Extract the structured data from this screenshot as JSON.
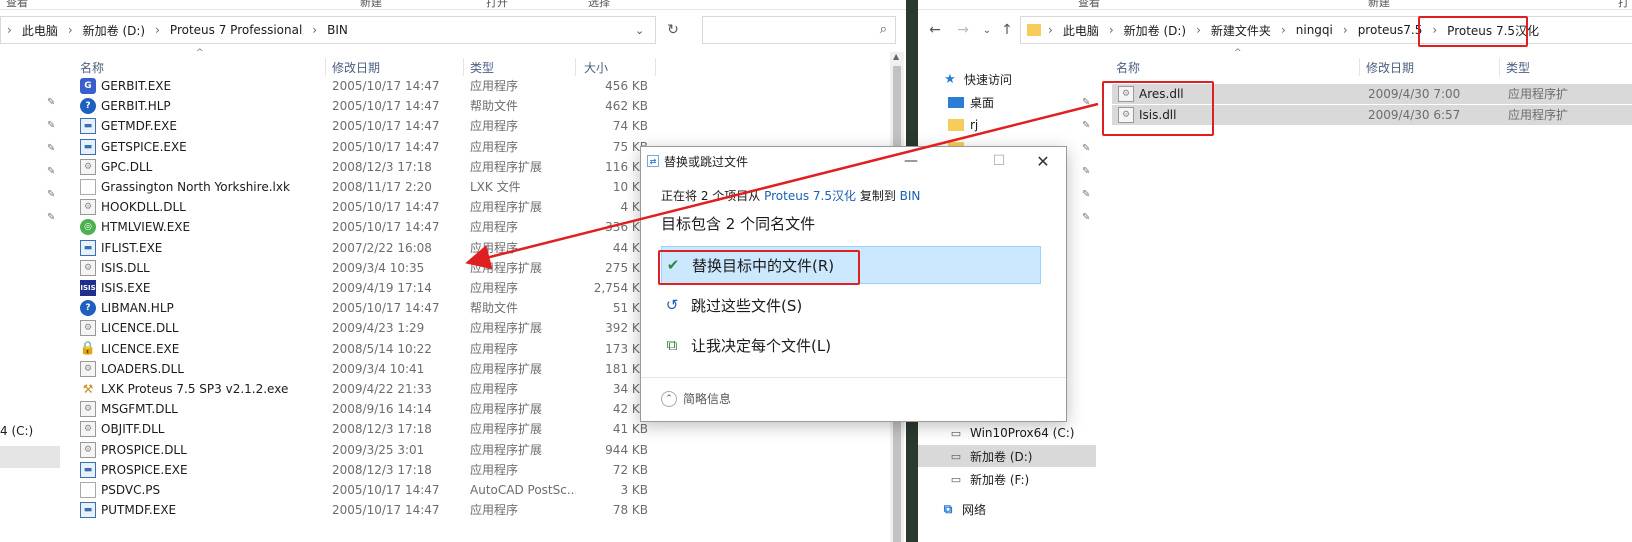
{
  "left": {
    "ribbon": [
      "查看",
      "新建",
      "打开",
      "选择"
    ],
    "breadcrumb": [
      "此电脑",
      "新加卷 (D:)",
      "Proteus 7 Professional",
      "BIN"
    ],
    "columns": {
      "name": "名称",
      "date": "修改日期",
      "type": "类型",
      "size": "大小"
    },
    "files": [
      {
        "name": "GERBIT.EXE",
        "date": "2005/10/17 14:47",
        "type": "应用程序",
        "size": "456 KB",
        "icon": "gerbit-icon"
      },
      {
        "name": "GERBIT.HLP",
        "date": "2005/10/17 14:47",
        "type": "帮助文件",
        "size": "462 KB",
        "icon": "help-icon"
      },
      {
        "name": "GETMDF.EXE",
        "date": "2005/10/17 14:47",
        "type": "应用程序",
        "size": "74 KB",
        "icon": "app-window-icon"
      },
      {
        "name": "GETSPICE.EXE",
        "date": "2005/10/17 14:47",
        "type": "应用程序",
        "size": "75 KB",
        "icon": "app-window-icon"
      },
      {
        "name": "GPC.DLL",
        "date": "2008/12/3 17:18",
        "type": "应用程序扩展",
        "size": "116 KB",
        "icon": "dll-icon"
      },
      {
        "name": "Grassington North Yorkshire.lxk",
        "date": "2008/11/17 2:20",
        "type": "LXK 文件",
        "size": "10 KB",
        "icon": "blank-file-icon"
      },
      {
        "name": "HOOKDLL.DLL",
        "date": "2005/10/17 14:47",
        "type": "应用程序扩展",
        "size": "4 KB",
        "icon": "dll-icon"
      },
      {
        "name": "HTMLVIEW.EXE",
        "date": "2005/10/17 14:47",
        "type": "应用程序",
        "size": "336 KB",
        "icon": "htmlview-icon"
      },
      {
        "name": "IFLIST.EXE",
        "date": "2007/2/22 16:08",
        "type": "应用程序",
        "size": "44 KB",
        "icon": "app-window-icon"
      },
      {
        "name": "ISIS.DLL",
        "date": "2009/3/4 10:35",
        "type": "应用程序扩展",
        "size": "275 KB",
        "icon": "dll-icon"
      },
      {
        "name": "ISIS.EXE",
        "date": "2009/4/19 17:14",
        "type": "应用程序",
        "size": "2,754 KB",
        "icon": "isis-icon"
      },
      {
        "name": "LIBMAN.HLP",
        "date": "2005/10/17 14:47",
        "type": "帮助文件",
        "size": "51 KB",
        "icon": "help-icon"
      },
      {
        "name": "LICENCE.DLL",
        "date": "2009/4/23 1:29",
        "type": "应用程序扩展",
        "size": "392 KB",
        "icon": "dll-icon"
      },
      {
        "name": "LICENCE.EXE",
        "date": "2008/5/14 10:22",
        "type": "应用程序",
        "size": "173 KB",
        "icon": "lock-icon"
      },
      {
        "name": "LOADERS.DLL",
        "date": "2009/3/4 10:41",
        "type": "应用程序扩展",
        "size": "181 KB",
        "icon": "dll-icon"
      },
      {
        "name": "LXK Proteus 7.5 SP3 v2.1.2.exe",
        "date": "2009/4/22 21:33",
        "type": "应用程序",
        "size": "34 KB",
        "icon": "installer-icon"
      },
      {
        "name": "MSGFMT.DLL",
        "date": "2008/9/16 14:14",
        "type": "应用程序扩展",
        "size": "42 KB",
        "icon": "dll-icon"
      },
      {
        "name": "OBJITF.DLL",
        "date": "2008/12/3 17:18",
        "type": "应用程序扩展",
        "size": "41 KB",
        "icon": "dll-icon"
      },
      {
        "name": "PROSPICE.DLL",
        "date": "2009/3/25 3:01",
        "type": "应用程序扩展",
        "size": "944 KB",
        "icon": "dll-icon"
      },
      {
        "name": "PROSPICE.EXE",
        "date": "2008/12/3 17:18",
        "type": "应用程序",
        "size": "72 KB",
        "icon": "app-window-icon"
      },
      {
        "name": "PSDVC.PS",
        "date": "2005/10/17 14:47",
        "type": "AutoCAD PostSc...",
        "size": "3 KB",
        "icon": "blank-file-icon"
      },
      {
        "name": "PUTMDF.EXE",
        "date": "2005/10/17 14:47",
        "type": "应用程序",
        "size": "78 KB",
        "icon": "app-window-icon"
      }
    ],
    "side_drive_label": "4 (C:)"
  },
  "right": {
    "ribbon": [
      "查看",
      "新建",
      "打开"
    ],
    "breadcrumb": [
      "此电脑",
      "新加卷 (D:)",
      "新建文件夹",
      "ningqi",
      "proteus7.5",
      "Proteus 7.5汉化"
    ],
    "columns": {
      "name": "名称",
      "date": "修改日期",
      "type": "类型"
    },
    "files": [
      {
        "name": "Ares.dll",
        "date": "2009/4/30 7:00",
        "type": "应用程序扩"
      },
      {
        "name": "Isis.dll",
        "date": "2009/4/30 6:57",
        "type": "应用程序扩"
      }
    ],
    "nav": {
      "quick_access": "快速访问",
      "desktop": "桌面",
      "folder_rj": "rj",
      "drive_c": "Win10Prox64 (C:)",
      "drive_d": "新加卷 (D:)",
      "drive_f": "新加卷 (F:)",
      "network": "网络"
    }
  },
  "dialog": {
    "title": "替换或跳过文件",
    "line1_prefix": "正在将 2 个项目从",
    "source": "Proteus 7.5汉化",
    "line1_middle": "复制到",
    "dest": "BIN",
    "heading": "目标包含 2 个同名文件",
    "opt_replace": "替换目标中的文件(R)",
    "opt_skip": "跳过这些文件(S)",
    "opt_decide": "让我决定每个文件(L)",
    "details": "简略信息"
  },
  "colors": {
    "link": "#1a5fb4",
    "selected_bg": "#cce8ff",
    "highlight": "#e02020"
  }
}
